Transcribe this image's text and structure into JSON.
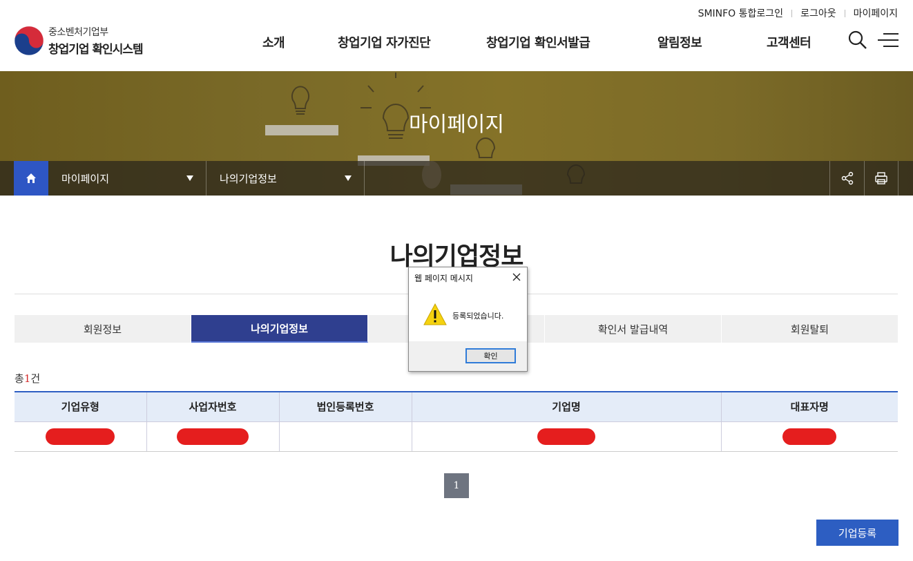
{
  "util_links": [
    "SMINFO 통합로그인",
    "로그아웃",
    "마이페이지"
  ],
  "logo": {
    "ministry": "중소벤처기업부",
    "system": "창업기업 확인시스템"
  },
  "gnb": [
    "소개",
    "창업기업 자가진단",
    "창업기업 확인서발급",
    "알림정보",
    "고객센터"
  ],
  "hero": {
    "title": "마이페이지"
  },
  "breadcrumb": {
    "level1": "마이페이지",
    "level2": "나의기업정보"
  },
  "page": {
    "title": "나의기업정보"
  },
  "tabs": [
    "회원정보",
    "나의기업정보",
    "",
    "확인서 발급내역",
    "회원탈퇴"
  ],
  "active_tab": "나의기업정보",
  "count": {
    "prefix": "총",
    "value": "1",
    "suffix": "건"
  },
  "table": {
    "headers": [
      "기업유형",
      "사업자번호",
      "법인등록번호",
      "기업명",
      "대표자명"
    ],
    "rows": [
      [
        "[redacted]",
        "[redacted]",
        "",
        "[redacted]",
        "[redacted]"
      ]
    ]
  },
  "pagination": {
    "current": "1"
  },
  "register_button": "기업등록",
  "dialog": {
    "title": "웹 페이지 메시지",
    "message": "등록되었습니다.",
    "ok_label": "확인"
  },
  "colors": {
    "primary": "#2d5ec2",
    "active_tab": "#2f3f8f",
    "hero": "#7a6a28",
    "redaction": "#e51e1e"
  }
}
